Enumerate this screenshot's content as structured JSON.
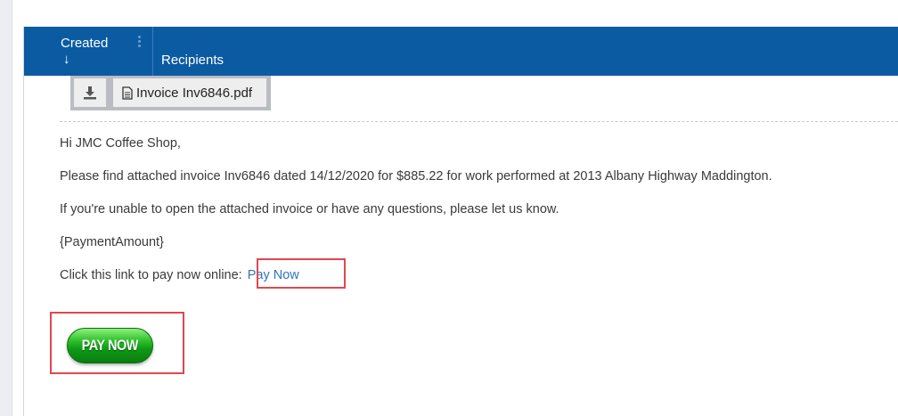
{
  "grid": {
    "header": {
      "created_label": "Created",
      "created_sort_glyph": "↓",
      "recipients_label": "Recipients"
    }
  },
  "attachment": {
    "download_icon": "download-icon",
    "file_icon": "document-icon",
    "filename": "Invoice Inv6846.pdf"
  },
  "email": {
    "greeting": "Hi JMC Coffee Shop,",
    "body_line": "Please find attached invoice Inv6846 dated 14/12/2020 for $885.22 for work performed at 2013 Albany Highway Maddington.",
    "help_line": "If you're unable to open the attached invoice or have any questions, please let us know.",
    "payment_placeholder": "{PaymentAmount}",
    "pay_prompt": "Click this link to pay now online:",
    "pay_link_label": "Pay Now",
    "pay_button_label": "PAY NOW"
  },
  "colors": {
    "header_bg": "#0b5ba3",
    "link": "#2a77b8",
    "highlight": "#e0484f",
    "pay_button": "#1aab1e"
  }
}
